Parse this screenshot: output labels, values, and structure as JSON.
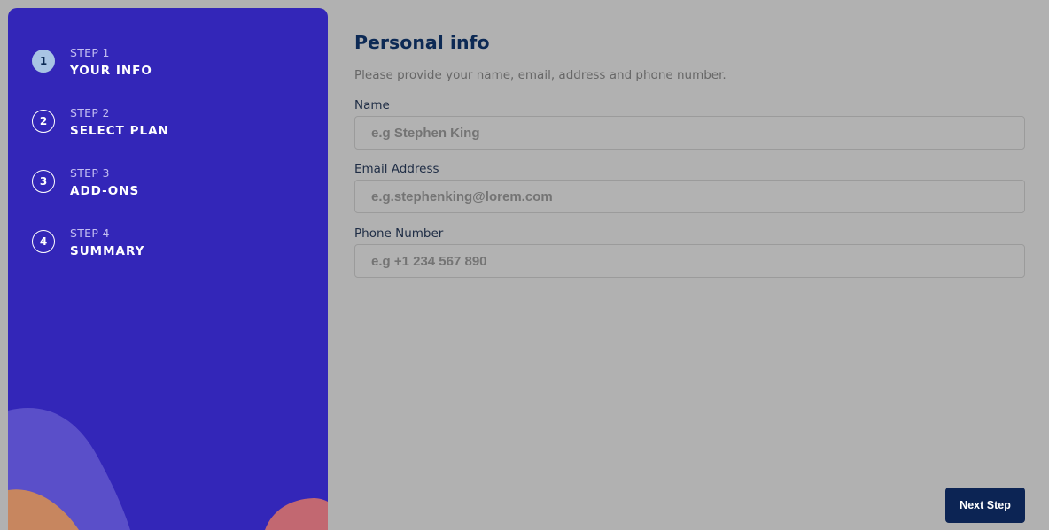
{
  "sidebar": {
    "steps": [
      {
        "number": "1",
        "kicker": "STEP 1",
        "title": "YOUR INFO",
        "active": true
      },
      {
        "number": "2",
        "kicker": "STEP 2",
        "title": "SELECT PLAN",
        "active": false
      },
      {
        "number": "3",
        "kicker": "STEP 3",
        "title": "ADD-ONS",
        "active": false
      },
      {
        "number": "4",
        "kicker": "STEP 4",
        "title": "SUMMARY",
        "active": false
      }
    ]
  },
  "main": {
    "title": "Personal info",
    "subtitle": "Please provide your name, email, address and phone number.",
    "fields": {
      "name": {
        "label": "Name",
        "placeholder": "e.g Stephen King",
        "value": ""
      },
      "email": {
        "label": "Email Address",
        "placeholder": "e.g.stephenking@lorem.com",
        "value": ""
      },
      "phone": {
        "label": "Phone Number",
        "placeholder": "e.g +1 234 567 890",
        "value": ""
      }
    },
    "next_label": "Next Step"
  },
  "colors": {
    "sidebar": "#3326b8",
    "active_step": "#a8c4e4",
    "primary_dark": "#0c2454",
    "overlay_background": "#b1b1b1"
  }
}
